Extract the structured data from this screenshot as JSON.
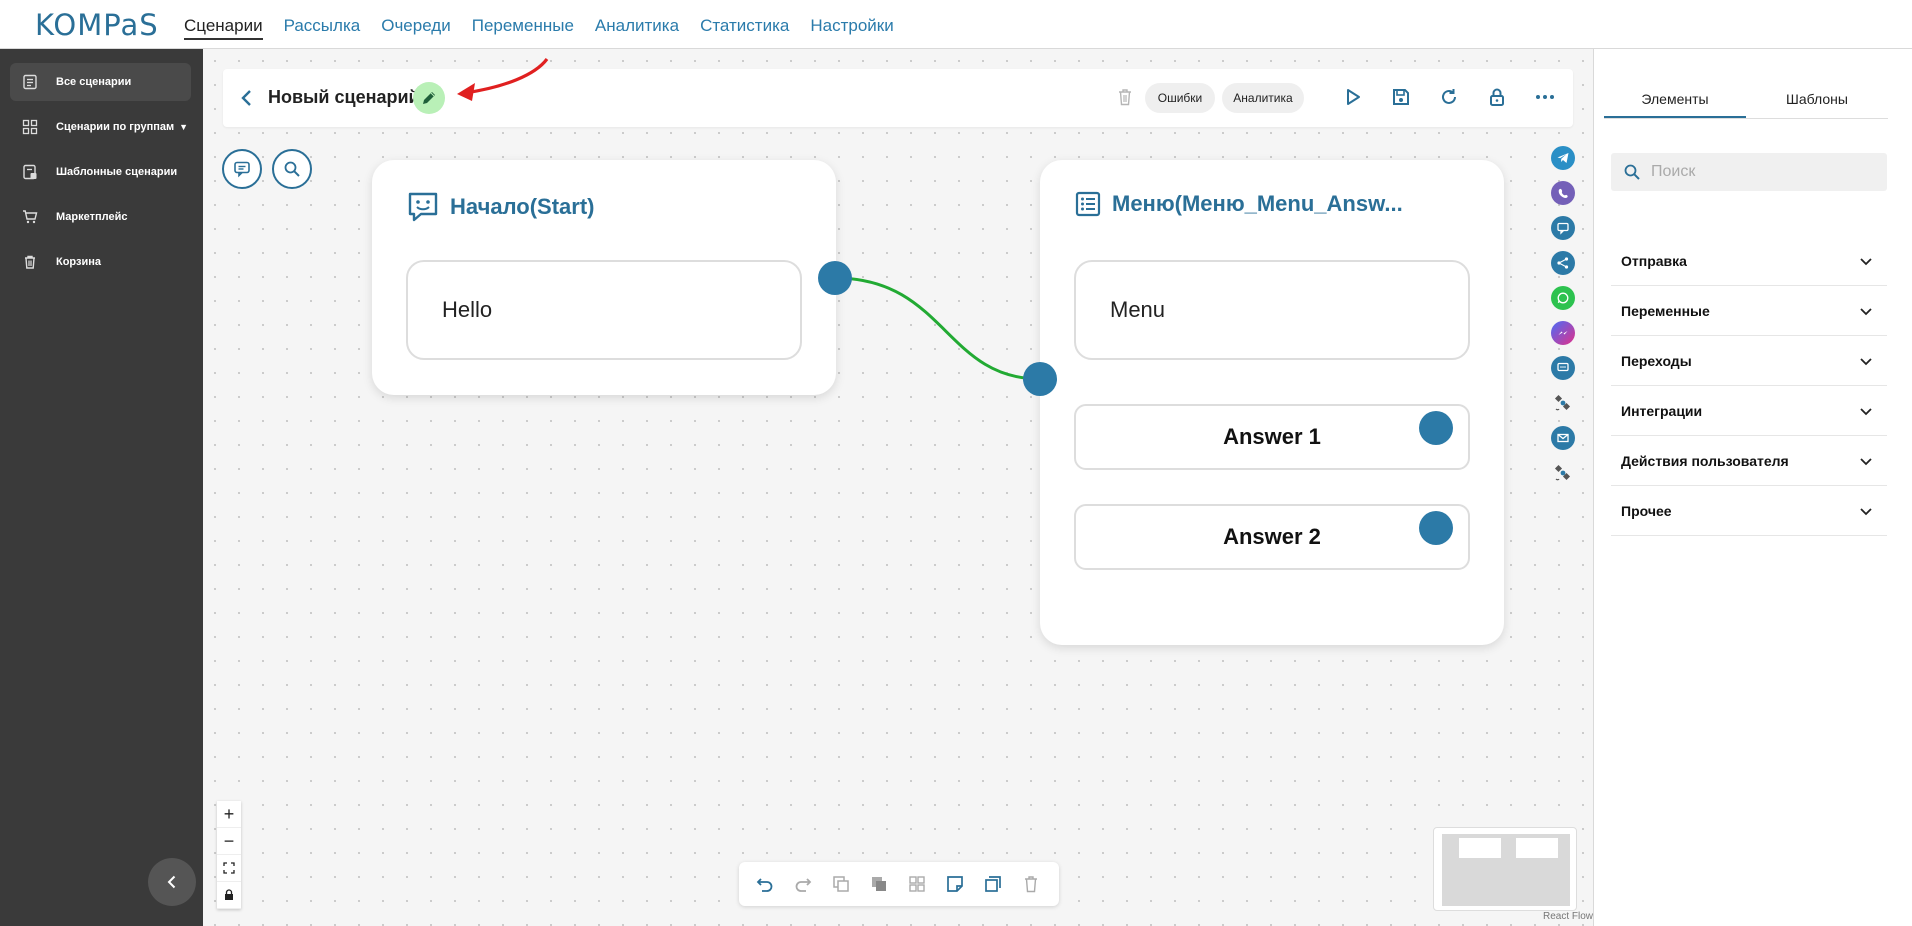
{
  "logo": "KOMPaS",
  "nav": {
    "items": [
      "Сценарии",
      "Рассылка",
      "Очереди",
      "Переменные",
      "Аналитика",
      "Статистика",
      "Настройки"
    ],
    "active_index": 0
  },
  "sidebar": {
    "items": [
      {
        "label": "Все сценарии",
        "icon": "list-icon"
      },
      {
        "label": "Сценарии по группам",
        "icon": "grid-icon"
      },
      {
        "label": "Шаблонные сценарии",
        "icon": "template-icon"
      },
      {
        "label": "Маркетплейс",
        "icon": "cart-icon"
      },
      {
        "label": "Корзина",
        "icon": "trash-icon"
      }
    ]
  },
  "header": {
    "title": "Новый сценарий",
    "errors_label": "Ошибки",
    "analytics_label": "Аналитика"
  },
  "nodes": {
    "start": {
      "title": "Начало(Start)",
      "message": "Hello"
    },
    "menu": {
      "title": "Меню(Меню_Menu_Answ...",
      "message": "Menu",
      "answers": [
        "Answer 1",
        "Answer 2"
      ]
    }
  },
  "canvas": {
    "reactflow_label": "React Flow"
  },
  "right_panel": {
    "tabs": [
      "Элементы",
      "Шаблоны"
    ],
    "search_placeholder": "Поиск",
    "sections": [
      "Отправка",
      "Переменные",
      "Переходы",
      "Интеграции",
      "Действия пользователя",
      "Прочее"
    ]
  },
  "colors": {
    "brand": "#2a6f97",
    "handle": "#2c7aa7",
    "edge": "#22aa33",
    "sidebar_bg": "#3a3a3a",
    "edit_btn": "#b9f0b7"
  }
}
